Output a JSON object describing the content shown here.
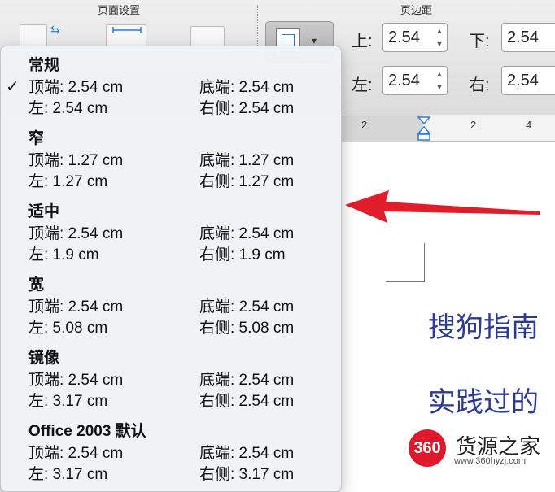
{
  "ribbon": {
    "page_setup_label": "页面设置",
    "margins_label": "页边距",
    "fields": [
      {
        "label": "上:",
        "value": "2.54"
      },
      {
        "label": "下:",
        "value": "2.54"
      },
      {
        "label": "左:",
        "value": "2.54"
      },
      {
        "label": "右:",
        "value": "2.54"
      }
    ]
  },
  "ruler": {
    "ticks": [
      "2",
      "2",
      "4"
    ]
  },
  "document": {
    "line1": "搜狗指南",
    "line2": "实践过的"
  },
  "menu": {
    "options": [
      {
        "name": "常规",
        "checked": "✓",
        "top": "顶端: 2.54 cm",
        "bottom": "底端: 2.54 cm",
        "left": "左:     2.54 cm",
        "right": "右侧: 2.54 cm"
      },
      {
        "name": "窄",
        "top": "顶端: 1.27 cm",
        "bottom": "底端: 1.27 cm",
        "left": "左:     1.27 cm",
        "right": "右侧: 1.27 cm"
      },
      {
        "name": "适中",
        "top": "顶端: 2.54 cm",
        "bottom": "底端: 2.54 cm",
        "left": "左:     1.9 cm",
        "right": "右侧: 1.9 cm"
      },
      {
        "name": "宽",
        "top": "顶端: 2.54 cm",
        "bottom": "底端: 2.54 cm",
        "left": "左:     5.08 cm",
        "right": "右侧: 5.08 cm"
      },
      {
        "name": "镜像",
        "top": "顶端: 2.54 cm",
        "bottom": "底端: 2.54 cm",
        "left": "左:     3.17 cm",
        "right": "右侧: 2.54 cm"
      },
      {
        "name": "Office 2003 默认",
        "top": "顶端: 2.54 cm",
        "bottom": "底端: 2.54 cm",
        "left": "左:     3.17 cm",
        "right": "右侧: 3.17 cm"
      }
    ]
  },
  "watermark": {
    "badge": "360",
    "name": "货源之家",
    "url": "www.360hyzj.com"
  },
  "colors": {
    "arrow": "#e01e2b",
    "doc_text": "#2c3a8f",
    "badge": "#e0182c"
  }
}
